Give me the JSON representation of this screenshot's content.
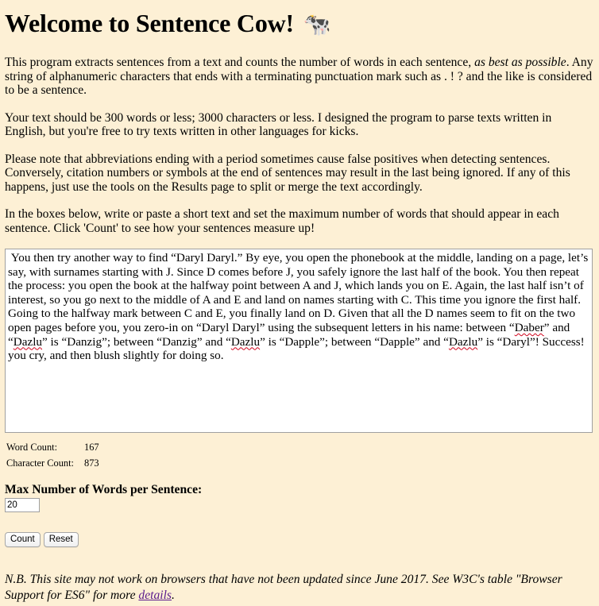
{
  "title": "Welcome to Sentence Cow!",
  "title_icon": "cow-icon",
  "intro": {
    "p1_a": "This program extracts sentences from a text and counts the number of words in each sentence, ",
    "p1_em": "as best as possible",
    "p1_b": ". Any string of alphanumeric characters that ends with a terminating punctuation mark such as . ! ? and the like is considered to be a sentence.",
    "p2": "Your text should be 300 words or less; 3000 characters or less. I designed the program to parse texts written in English, but you're free to try texts written in other languages for kicks.",
    "p3": "Please note that abbreviations ending with a period sometimes cause false positives when detecting sentences. Conversely, citation numbers or symbols at the end of sentences may result in the last being ignored. If any of this happens, just use the tools on the Results page to split or merge the text accordingly.",
    "p4": "In the boxes below, write or paste a short text and set the maximum number of words that should appear in each sentence. Click 'Count' to see how your sentences measure up!"
  },
  "textbox": {
    "t1": " You then try another way to find “Daryl Daryl.” By eye, you open the phonebook at the middle, landing on a page, let’s say, with surnames starting with J. Since D comes before J, you safely ignore the last half of the book. You then repeat the process: you open the book at the halfway point between A and J, which lands you on E. Again, the last half isn’t of interest, so you go next to the middle of A and E and land on names starting with C. This time you ignore the first half. Going to the halfway mark between C and E, you finally land on D. Given that all the D names seem to fit on the two open pages before you, you zero-in on “Daryl Daryl” using the subsequent letters in his name: between “",
    "w1": "Daber",
    "t2": "” and “",
    "w2": "Dazlu",
    "t3": "” is “Danzig”; between “Danzig” and “",
    "w3": "Dazlu",
    "t4": "” is “Dapple”; between “Dapple” and “",
    "w4": "Dazlu",
    "t5": "” is “Daryl”! Success! you cry, and then blush slightly for doing so."
  },
  "counts": {
    "word_label": "Word Count:",
    "word_value": "167",
    "char_label": "Character Count:",
    "char_value": "873"
  },
  "max_words": {
    "label": "Max Number of Words per Sentence:",
    "value": "20"
  },
  "buttons": {
    "count": "Count",
    "reset": "Reset"
  },
  "note": {
    "text": "N.B. This site may not work on browsers that have not been updated since June 2017. See W3C's table \"Browser Support for ES6\" for more ",
    "link": "details",
    "end": "."
  }
}
